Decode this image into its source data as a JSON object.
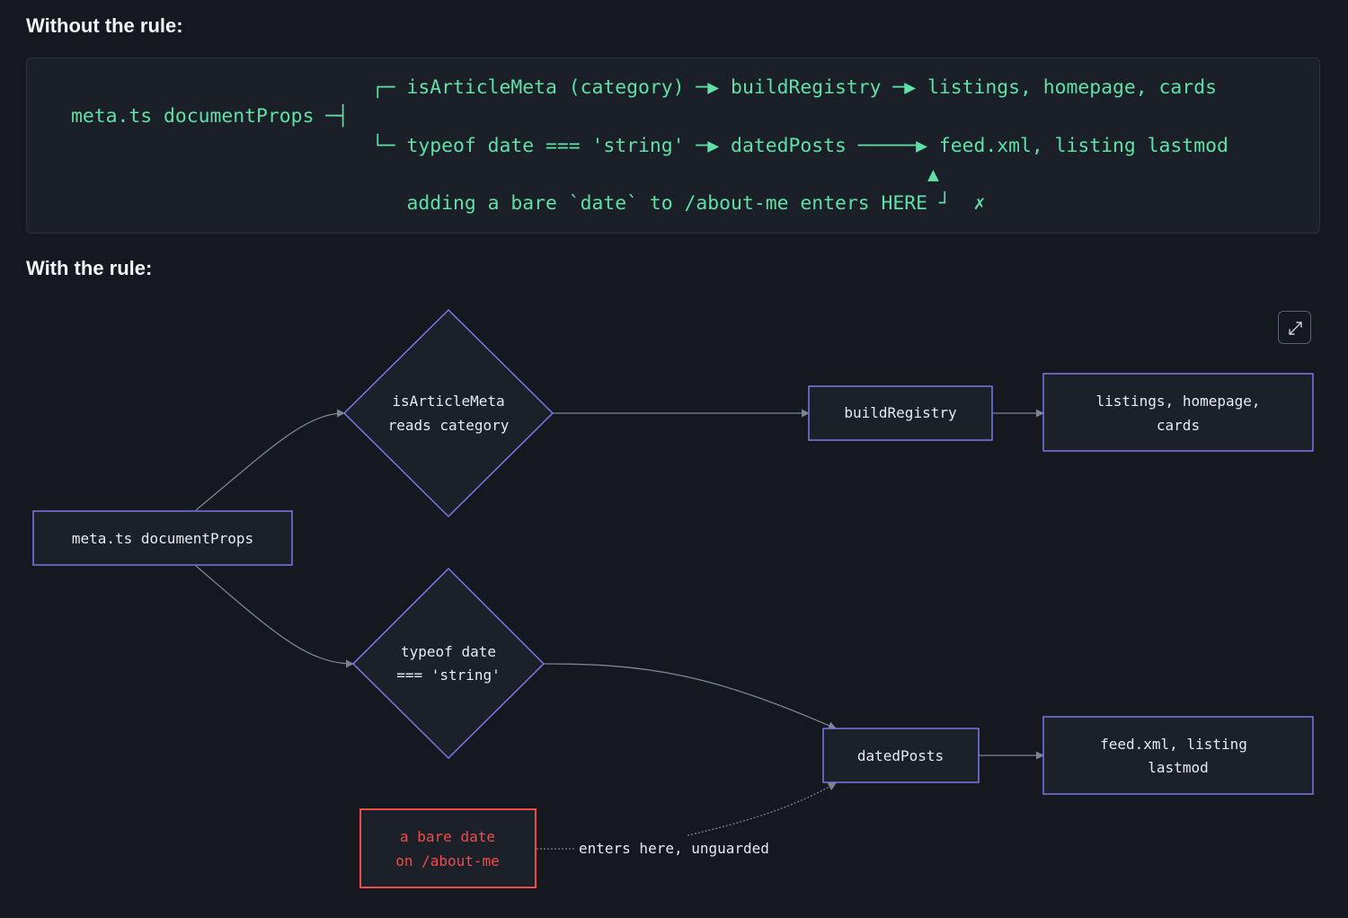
{
  "headings": {
    "without": "Without the rule:",
    "with": "With the rule:"
  },
  "code_block": {
    "lines": [
      "                          ┌─ isArticleMeta (category) ─▶ buildRegistry ─▶ listings, homepage, cards",
      "meta.ts documentProps ─┤",
      "                          └─ typeof date === 'string' ─▶ datedPosts ─────▶ feed.xml, listing lastmod",
      "                                                                          ▲",
      "                             adding a bare `date` to /about-me enters HERE ┘  ✗"
    ]
  },
  "diagram": {
    "nodes": {
      "source": {
        "line1": "meta.ts documentProps"
      },
      "is_article_meta": {
        "line1": "isArticleMeta",
        "line2": "reads category"
      },
      "typeof_date": {
        "line1": "typeof date",
        "line2": "=== 'string'"
      },
      "build_registry": {
        "line1": "buildRegistry"
      },
      "dated_posts": {
        "line1": "datedPosts"
      },
      "listings": {
        "line1": "listings, homepage,",
        "line2": "cards"
      },
      "feed": {
        "line1": "feed.xml, listing",
        "line2": "lastmod"
      },
      "bare_date": {
        "line1": "a bare date",
        "line2": "on /about-me"
      }
    },
    "edge_label": "enters here, unguarded"
  },
  "icons": {
    "expand": "expand-icon"
  },
  "colors": {
    "background": "#15181e",
    "code_text": "#5fe0a6",
    "node_border": "#7a78e6",
    "node_fill": "#1c2029",
    "warning": "#ef4c4c",
    "edge": "#7c8494"
  }
}
